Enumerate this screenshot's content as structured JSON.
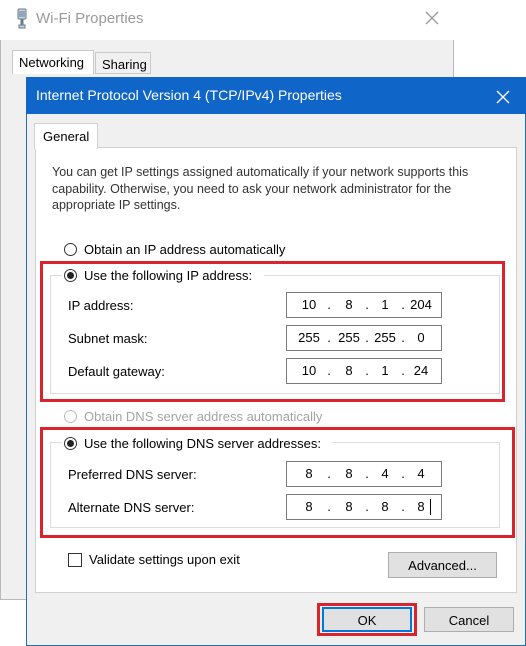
{
  "background_window": {
    "title": "Wi-Fi Properties",
    "tabs": [
      {
        "label": "Networking",
        "selected": true
      },
      {
        "label": "Sharing",
        "selected": false
      }
    ]
  },
  "dialog": {
    "title": "Internet Protocol Version 4 (TCP/IPv4) Properties",
    "tab_general": "General",
    "description": "You can get IP settings assigned automatically if your network supports this capability. Otherwise, you need to ask your network administrator for the appropriate IP settings.",
    "ip_auto_label": "Obtain an IP address automatically",
    "ip_manual_label": "Use the following IP address:",
    "ip_fields": [
      {
        "label": "IP address:",
        "octets": [
          "10",
          "8",
          "1",
          "204"
        ]
      },
      {
        "label": "Subnet mask:",
        "octets": [
          "255",
          "255",
          "255",
          "0"
        ]
      },
      {
        "label": "Default gateway:",
        "octets": [
          "10",
          "8",
          "1",
          "24"
        ]
      }
    ],
    "dns_auto_label": "Obtain DNS server address automatically",
    "dns_manual_label": "Use the following DNS server addresses:",
    "dns_fields": [
      {
        "label": "Preferred DNS server:",
        "octets": [
          "8",
          "8",
          "4",
          "4"
        ]
      },
      {
        "label": "Alternate DNS server:",
        "octets": [
          "8",
          "8",
          "8",
          "8"
        ]
      }
    ],
    "validate_label": "Validate settings upon exit",
    "advanced_label": "Advanced...",
    "ok_label": "OK",
    "cancel_label": "Cancel"
  },
  "colors": {
    "titlebar": "#0f66c8",
    "highlight": "#d9232d",
    "focus": "#0078d7"
  }
}
